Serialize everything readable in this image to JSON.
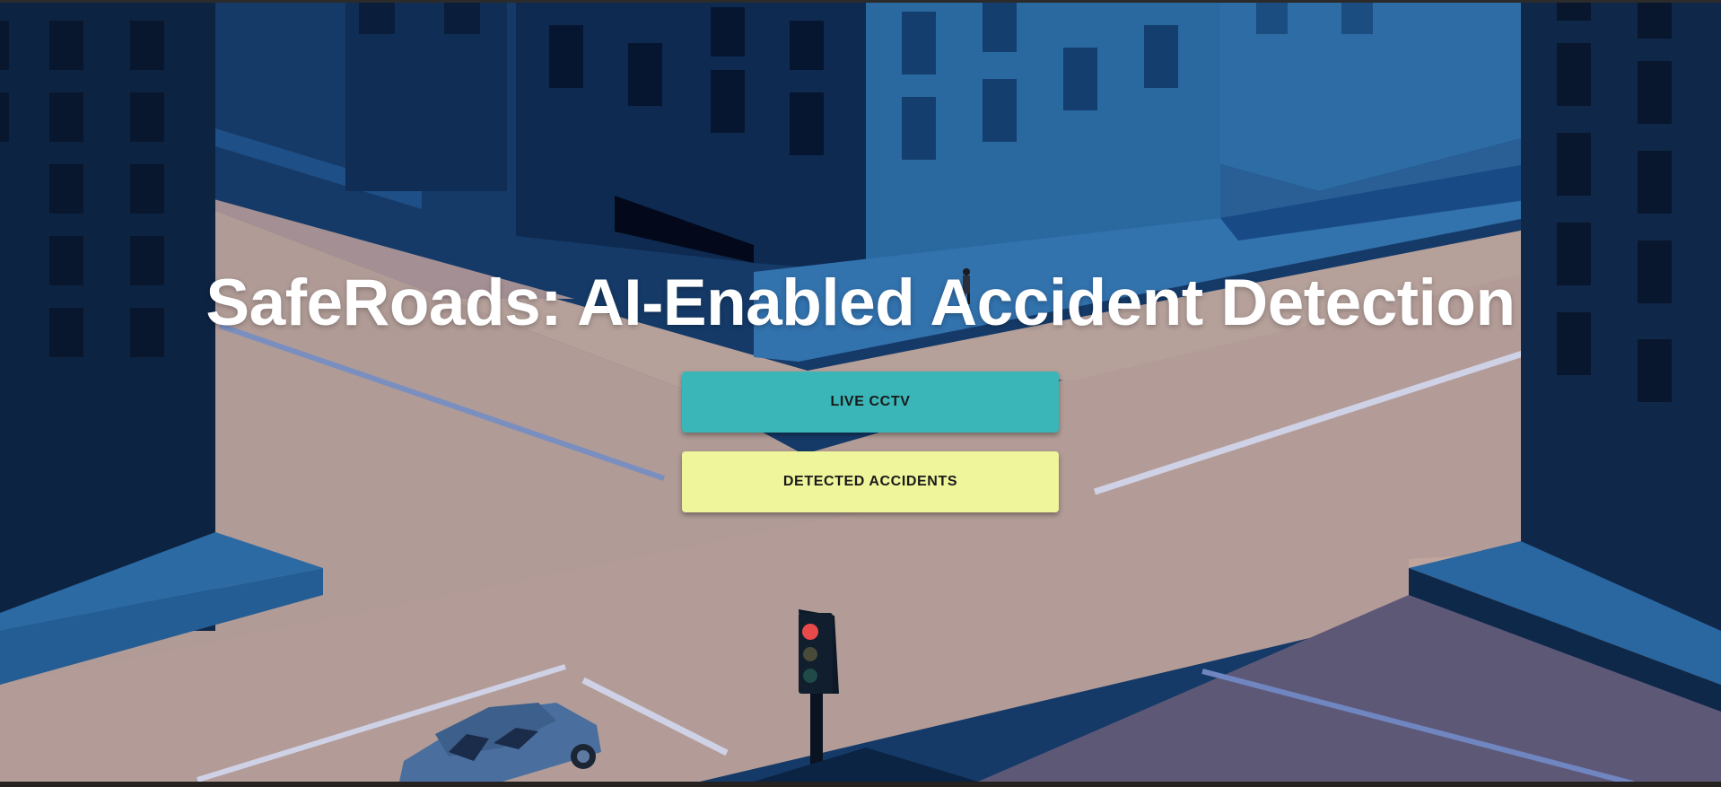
{
  "hero": {
    "title": "SafeRoads: AI-Enabled Accident Detection"
  },
  "actions": {
    "live_cctv_label": "LIVE CCTV",
    "detected_accidents_label": "DETECTED ACCIDENTS"
  },
  "colors": {
    "live_cctv_button": "#3ab5b8",
    "detected_accidents_button": "#eff59a",
    "title_text": "#ffffff",
    "road": "#b39c97",
    "building_dark": "#0f2748",
    "building_light": "#2a68a0"
  },
  "background": {
    "illustration": "isometric-city-intersection",
    "icons": [
      "building-icon",
      "traffic-light-icon",
      "car-icon",
      "pedestrian-icon"
    ]
  }
}
